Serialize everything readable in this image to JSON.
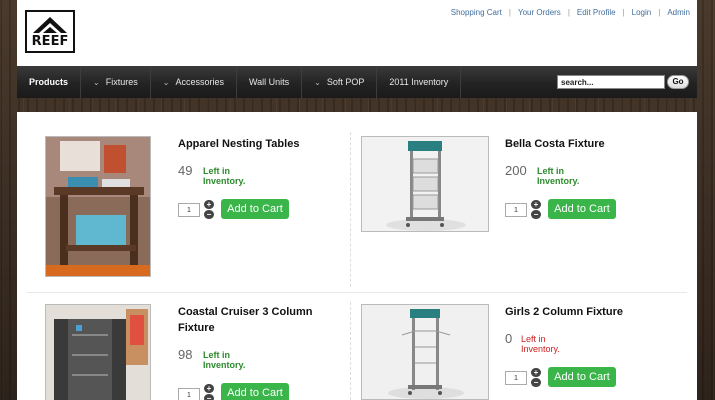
{
  "brand": {
    "logo_text": "REEF"
  },
  "toplinks": [
    "Shopping Cart",
    "Your Orders",
    "Edit Profile",
    "Login",
    "Admin"
  ],
  "nav": {
    "items": [
      {
        "label": "Products",
        "chevron": false,
        "active": true
      },
      {
        "label": "Fixtures",
        "chevron": true,
        "active": false
      },
      {
        "label": "Accessories",
        "chevron": true,
        "active": false
      },
      {
        "label": "Wall Units",
        "chevron": false,
        "active": false
      },
      {
        "label": "Soft POP",
        "chevron": true,
        "active": false
      },
      {
        "label": "2011 Inventory",
        "chevron": false,
        "active": false
      }
    ],
    "search_value": "search...",
    "go_label": "Go"
  },
  "products": [
    {
      "title": "Apparel Nesting Tables",
      "count": "49",
      "status": "Left in Inventory.",
      "in_stock": true,
      "qty": "1"
    },
    {
      "title": "Bella Costa Fixture",
      "count": "200",
      "status": "Left in Inventory.",
      "in_stock": true,
      "qty": "1"
    },
    {
      "title": "Coastal Cruiser 3 Column Fixture",
      "count": "98",
      "status": "Left in Inventory.",
      "in_stock": true,
      "qty": "1"
    },
    {
      "title": "Girls 2 Column Fixture",
      "count": "0",
      "status": "Left in Inventory.",
      "in_stock": false,
      "qty": "1"
    }
  ],
  "cart_label": "Add to Cart",
  "stepper": {
    "plus": "+",
    "minus": "−"
  },
  "colors": {
    "accent_green": "#39b54a",
    "in_stock_text": "#2e8b2e",
    "out_stock_text": "#cc2020",
    "link_blue": "#3f6f9f"
  }
}
